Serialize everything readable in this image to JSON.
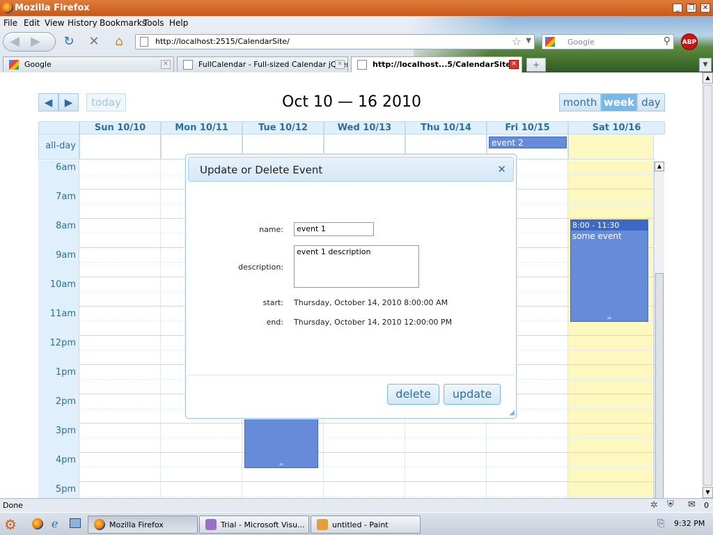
{
  "window": {
    "title": "Mozilla Firefox"
  },
  "menu": [
    "File",
    "Edit",
    "View",
    "History",
    "Bookmarks",
    "Tools",
    "Help"
  ],
  "toolbar": {
    "back_icon": "back-arrow-icon",
    "forward_icon": "forward-arrow-icon",
    "reload_icon": "reload-icon",
    "stop_icon": "stop-icon",
    "home_icon": "home-icon",
    "url": "http://localhost:2515/CalendarSite/",
    "search_placeholder": "Google",
    "abp_label": "ABP"
  },
  "tabs": [
    {
      "label": "Google",
      "selected": false
    },
    {
      "label": "FullCalendar - Full-sized Calendar jQuer...",
      "selected": false
    },
    {
      "label": "http://localhost...5/CalendarSite/",
      "selected": true
    }
  ],
  "calendar": {
    "title": "Oct 10 — 16 2010",
    "today_label": "today",
    "views": [
      "month",
      "week",
      "day"
    ],
    "active_view": "week",
    "all_day_label": "all-day",
    "days": [
      "Sun 10/10",
      "Mon 10/11",
      "Tue 10/12",
      "Wed 10/13",
      "Thu 10/14",
      "Fri 10/15",
      "Sat 10/16"
    ],
    "times": [
      "6am",
      "7am",
      "8am",
      "9am",
      "10am",
      "11am",
      "12pm",
      "1pm",
      "2pm",
      "3pm",
      "4pm",
      "5pm"
    ],
    "all_day_events": [
      {
        "title": "event 2",
        "day": "Fri 10/15"
      }
    ],
    "events": [
      {
        "time": "8:00 - 11:30",
        "title": "some event",
        "day": "Sat 10/16"
      },
      {
        "time": "",
        "title": "",
        "day": "Tue 10/12"
      }
    ],
    "today_color": "#fcf8c0"
  },
  "dialog": {
    "title": "Update or Delete Event",
    "close_icon": "close-icon",
    "name_label": "name:",
    "name_value": "event 1",
    "description_label": "description:",
    "description_value": "event 1 description",
    "start_label": "start:",
    "start_value": "Thursday, October 14, 2010 8:00:00 AM",
    "end_label": "end:",
    "end_value": "Thursday, October 14, 2010 12:00:00 PM",
    "delete_label": "delete",
    "update_label": "update"
  },
  "status": {
    "text": "Done"
  },
  "taskbar": {
    "tasks": [
      "Mozilla Firefox",
      "Trial - Microsoft Visu...",
      "untitled - Paint"
    ],
    "clock": "9:32 PM",
    "mail_count": "0"
  }
}
